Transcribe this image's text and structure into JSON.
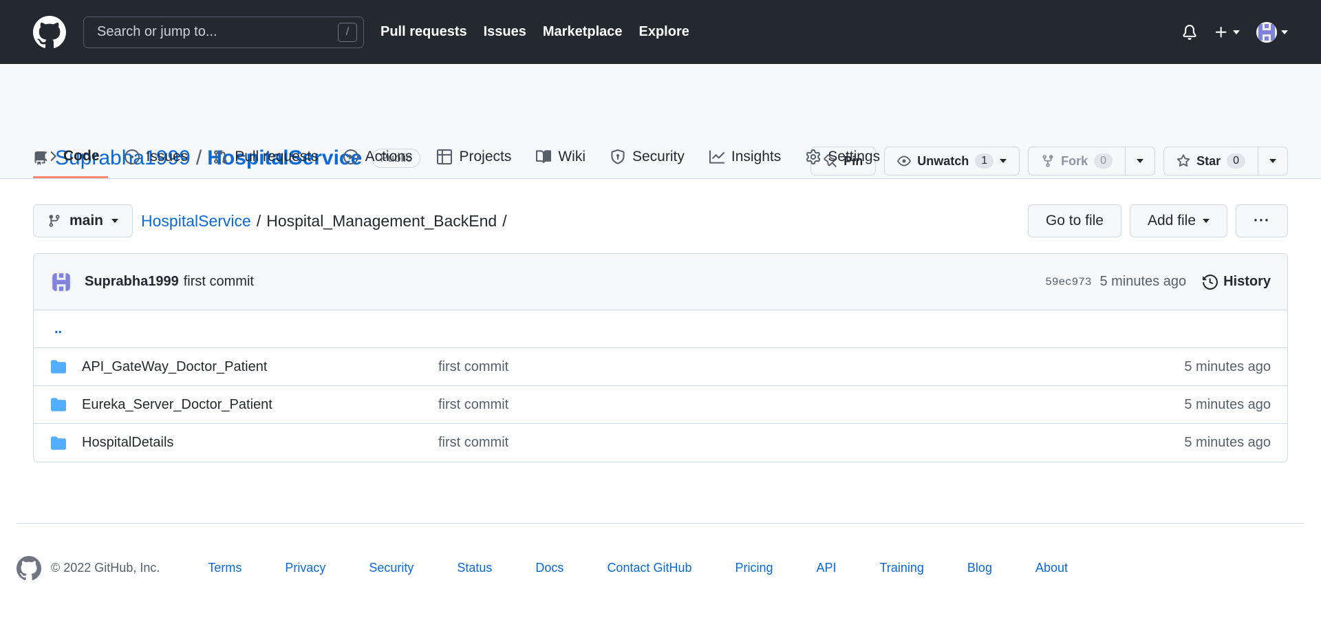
{
  "header": {
    "search_placeholder": "Search or jump to...",
    "slash_key": "/",
    "nav": [
      "Pull requests",
      "Issues",
      "Marketplace",
      "Explore"
    ]
  },
  "repo": {
    "owner": "Suprabha1999",
    "separator": "/",
    "name": "HospitalService",
    "visibility": "Public",
    "pin_label": "Pin",
    "watch_label": "Unwatch",
    "watch_count": "1",
    "fork_label": "Fork",
    "fork_count": "0",
    "star_label": "Star",
    "star_count": "0"
  },
  "tabs": [
    "Code",
    "Issues",
    "Pull requests",
    "Actions",
    "Projects",
    "Wiki",
    "Security",
    "Insights",
    "Settings"
  ],
  "filebar": {
    "branch": "main",
    "crumb_root": "HospitalService",
    "crumb_sep": "/",
    "crumb_current": "Hospital_Management_BackEnd",
    "crumb_trailing": "/",
    "go_to_file": "Go to file",
    "add_file": "Add file",
    "more": "···"
  },
  "latest_commit": {
    "author": "Suprabha1999",
    "message": "first commit",
    "sha": "59ec973",
    "age": "5 minutes ago",
    "history_label": "History"
  },
  "parent_dir": "..",
  "files": [
    {
      "name": "API_GateWay_Doctor_Patient",
      "message": "first commit",
      "age": "5 minutes ago"
    },
    {
      "name": "Eureka_Server_Doctor_Patient",
      "message": "first commit",
      "age": "5 minutes ago"
    },
    {
      "name": "HospitalDetails",
      "message": "first commit",
      "age": "5 minutes ago"
    }
  ],
  "footer": {
    "copyright": "© 2022 GitHub, Inc.",
    "links": [
      "Terms",
      "Privacy",
      "Security",
      "Status",
      "Docs",
      "Contact GitHub",
      "Pricing",
      "API",
      "Training",
      "Blog",
      "About"
    ]
  },
  "colors": {
    "header_bg": "#24292f",
    "link": "#0969da",
    "active_tab": "#fd8c73",
    "folder": "#54aeff"
  }
}
